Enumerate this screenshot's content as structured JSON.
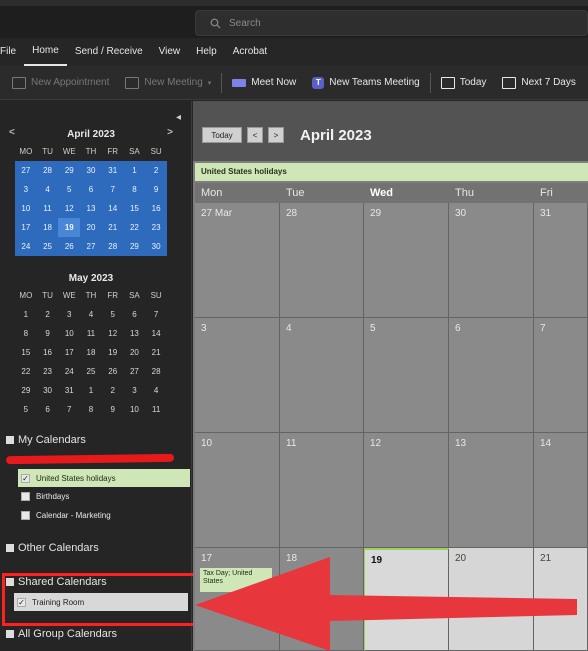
{
  "search": {
    "placeholder": "Search",
    "icon": "search-icon"
  },
  "menu": [
    "File",
    "Home",
    "Send / Receive",
    "View",
    "Help",
    "Acrobat"
  ],
  "ribbon": {
    "new_appointment": "New Appointment",
    "new_meeting": "New Meeting",
    "meet_now": "Meet Now",
    "new_teams_meeting": "New Teams Meeting",
    "today": "Today",
    "next_7_days": "Next 7 Days"
  },
  "mini_april": {
    "title": "April 2023",
    "prev": "<",
    "next": ">",
    "day_names": [
      "MO",
      "TU",
      "WE",
      "TH",
      "FR",
      "SA",
      "SU"
    ],
    "days": [
      "27",
      "28",
      "29",
      "30",
      "31",
      "1",
      "2",
      "3",
      "4",
      "5",
      "6",
      "7",
      "8",
      "9",
      "10",
      "11",
      "12",
      "13",
      "14",
      "15",
      "16",
      "17",
      "18",
      "19",
      "20",
      "21",
      "22",
      "23",
      "24",
      "25",
      "26",
      "27",
      "28",
      "29",
      "30"
    ],
    "today_index": 23
  },
  "mini_may": {
    "title": "May 2023",
    "day_names": [
      "MO",
      "TU",
      "WE",
      "TH",
      "FR",
      "SA",
      "SU"
    ],
    "days": [
      "1",
      "2",
      "3",
      "4",
      "5",
      "6",
      "7",
      "8",
      "9",
      "10",
      "11",
      "12",
      "13",
      "14",
      "15",
      "16",
      "17",
      "18",
      "19",
      "20",
      "21",
      "22",
      "23",
      "24",
      "25",
      "26",
      "27",
      "28",
      "29",
      "30",
      "31",
      "1",
      "2",
      "3",
      "4",
      "5",
      "6",
      "7",
      "8",
      "9",
      "10",
      "11"
    ]
  },
  "folders": {
    "my_calendars": "My Calendars",
    "us_holidays": "United States holidays",
    "birthdays": "Birthdays",
    "calendar_marketing": "Calendar - Marketing",
    "other_calendars": "Other Calendars",
    "shared_calendars": "Shared Calendars",
    "training_room": "Training Room",
    "all_group_calendars": "All Group Calendars"
  },
  "main": {
    "today_button": "Today",
    "prev": "<",
    "next": ">",
    "title": "April 2023",
    "holiday_band": "United States holidays",
    "day_headers": [
      "Mon",
      "Tue",
      "Wed",
      "Thu",
      "Fri"
    ],
    "weeks": [
      [
        "27 Mar",
        "28",
        "29",
        "30",
        "31"
      ],
      [
        "3",
        "4",
        "5",
        "6",
        "7"
      ],
      [
        "10",
        "11",
        "12",
        "13",
        "14"
      ],
      [
        "17",
        "18",
        "19",
        "20",
        "21"
      ]
    ],
    "event": "Tax Day; United States"
  },
  "colors": {
    "selected_month": "#2e6bbd",
    "holiday_green": "#cfe6b6",
    "highlight_red": "#ff2020",
    "arrow_red": "#e8363d"
  }
}
